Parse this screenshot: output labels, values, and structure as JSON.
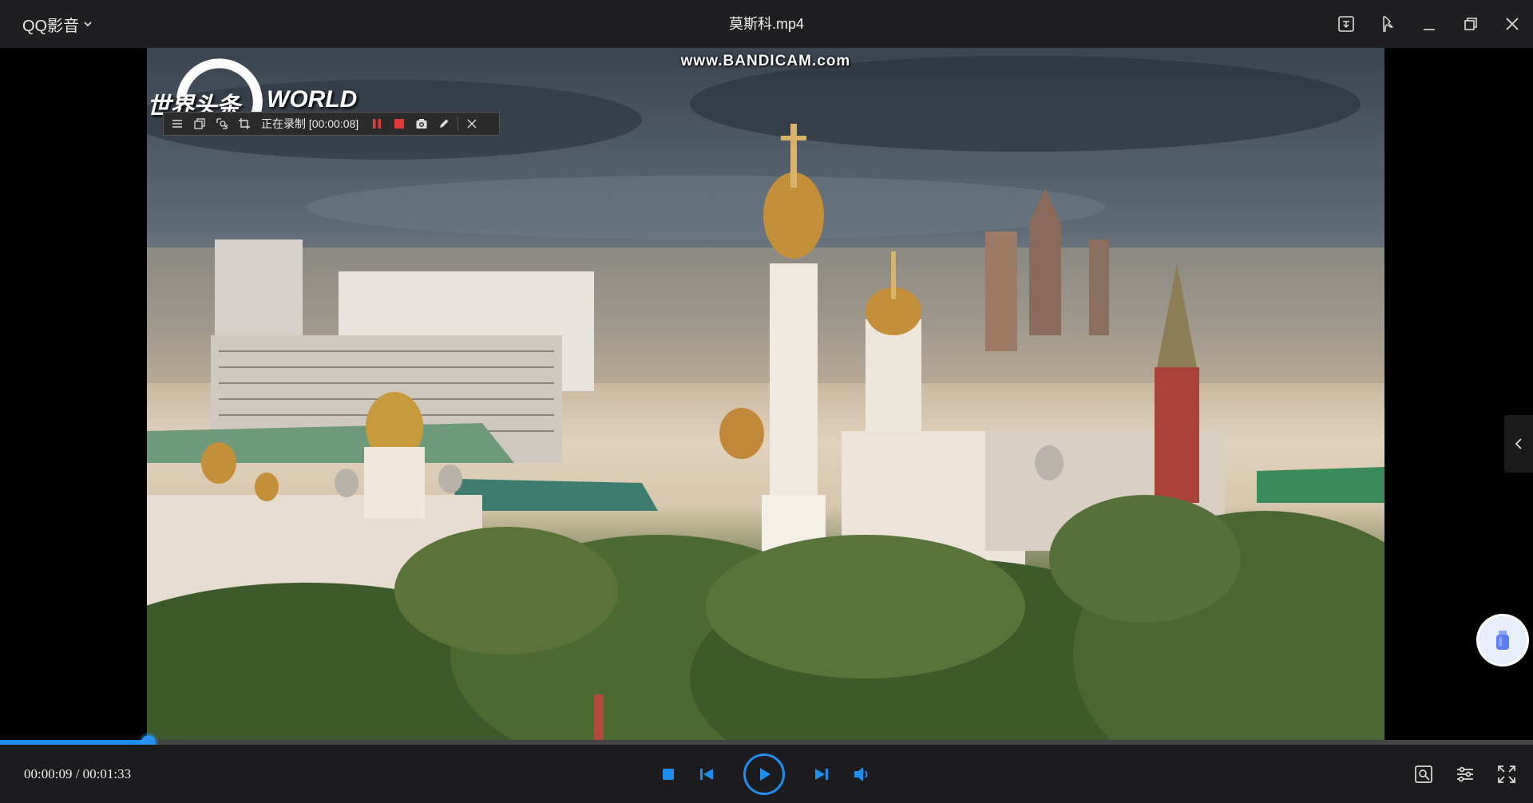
{
  "titlebar": {
    "app_name": "QQ影音",
    "file_name": "莫斯科.mp4",
    "buttons": [
      "cast-icon",
      "pin-icon",
      "minimize-icon",
      "restore-icon",
      "close-icon"
    ]
  },
  "video": {
    "watermark": "www.BANDICAM.com",
    "logo_cn": "世界头条",
    "logo_en": "WORLD",
    "recorder": {
      "status": "正在录制 [00:00:08]",
      "tools": [
        "menu-icon",
        "window-icon",
        "region-icon",
        "crop-icon",
        "pause-icon",
        "stop-icon",
        "camera-icon",
        "pencil-icon",
        "close-icon"
      ]
    }
  },
  "player": {
    "current_time": "00:00:09",
    "total_time": "00:01:33",
    "time_display": "00:00:09 / 00:01:33",
    "progress_fraction": 0.097,
    "accent": "#1e8ff0"
  }
}
